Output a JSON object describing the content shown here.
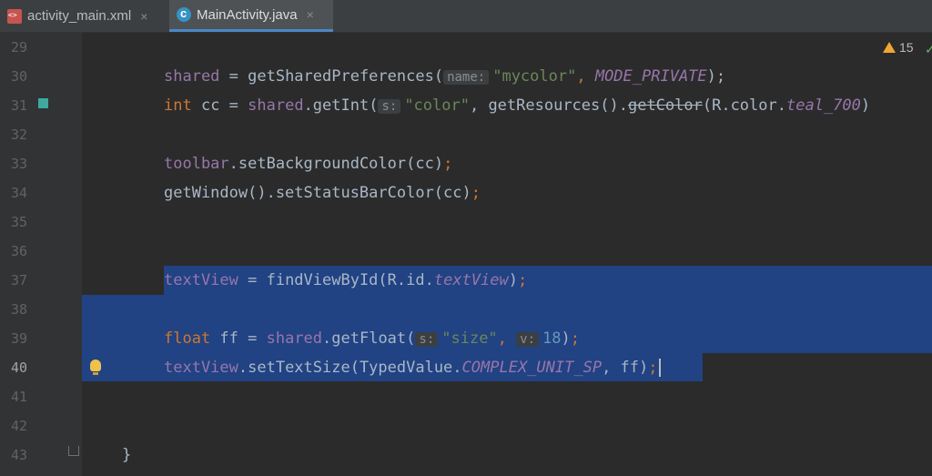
{
  "tabs": [
    {
      "label": "activity_main.xml",
      "close": "×"
    },
    {
      "label": "MainActivity.java",
      "close": "×"
    }
  ],
  "warnings": {
    "count": "15"
  },
  "line_numbers": [
    "29",
    "30",
    "31",
    "32",
    "33",
    "34",
    "35",
    "36",
    "37",
    "38",
    "39",
    "40",
    "41",
    "42",
    "43"
  ],
  "code": {
    "l30": {
      "a": "shared",
      "b": " = getSharedPreferences(",
      "hint": "name:",
      "c": "\"mycolor\"",
      "d": ", ",
      "e": "MODE_PRIVATE",
      "f": ");"
    },
    "l31": {
      "a": "int",
      "b": " cc = ",
      "c": "shared",
      "d": ".getInt(",
      "hint": "s:",
      "e": "\"color\"",
      "f": ", getResources().",
      "g": "getColor",
      "h": "(R.color.",
      "i": "teal_700",
      "j": ")"
    },
    "l33": {
      "a": "toolbar",
      "b": ".setBackgroundColor(cc)",
      "c": ";"
    },
    "l34": {
      "a": "getWindow().setStatusBarColor(cc)",
      "b": ";"
    },
    "l37": {
      "a": "textView",
      "b": " = findViewById(R.id.",
      "c": "textView",
      "d": ")",
      "e": ";"
    },
    "l39": {
      "a": "float",
      "b": " ff = ",
      "c": "shared",
      "d": ".getFloat(",
      "hint1": "s:",
      "e": "\"size\"",
      "f": ", ",
      "hint2": "v:",
      "g": "18",
      "h": ")",
      "i": ";"
    },
    "l40": {
      "a": "textView",
      "b": ".setTextSize(TypedValue.",
      "c": "COMPLEX_UNIT_SP",
      "d": ", ff)",
      "e": ";"
    },
    "l43": {
      "a": "}"
    }
  }
}
